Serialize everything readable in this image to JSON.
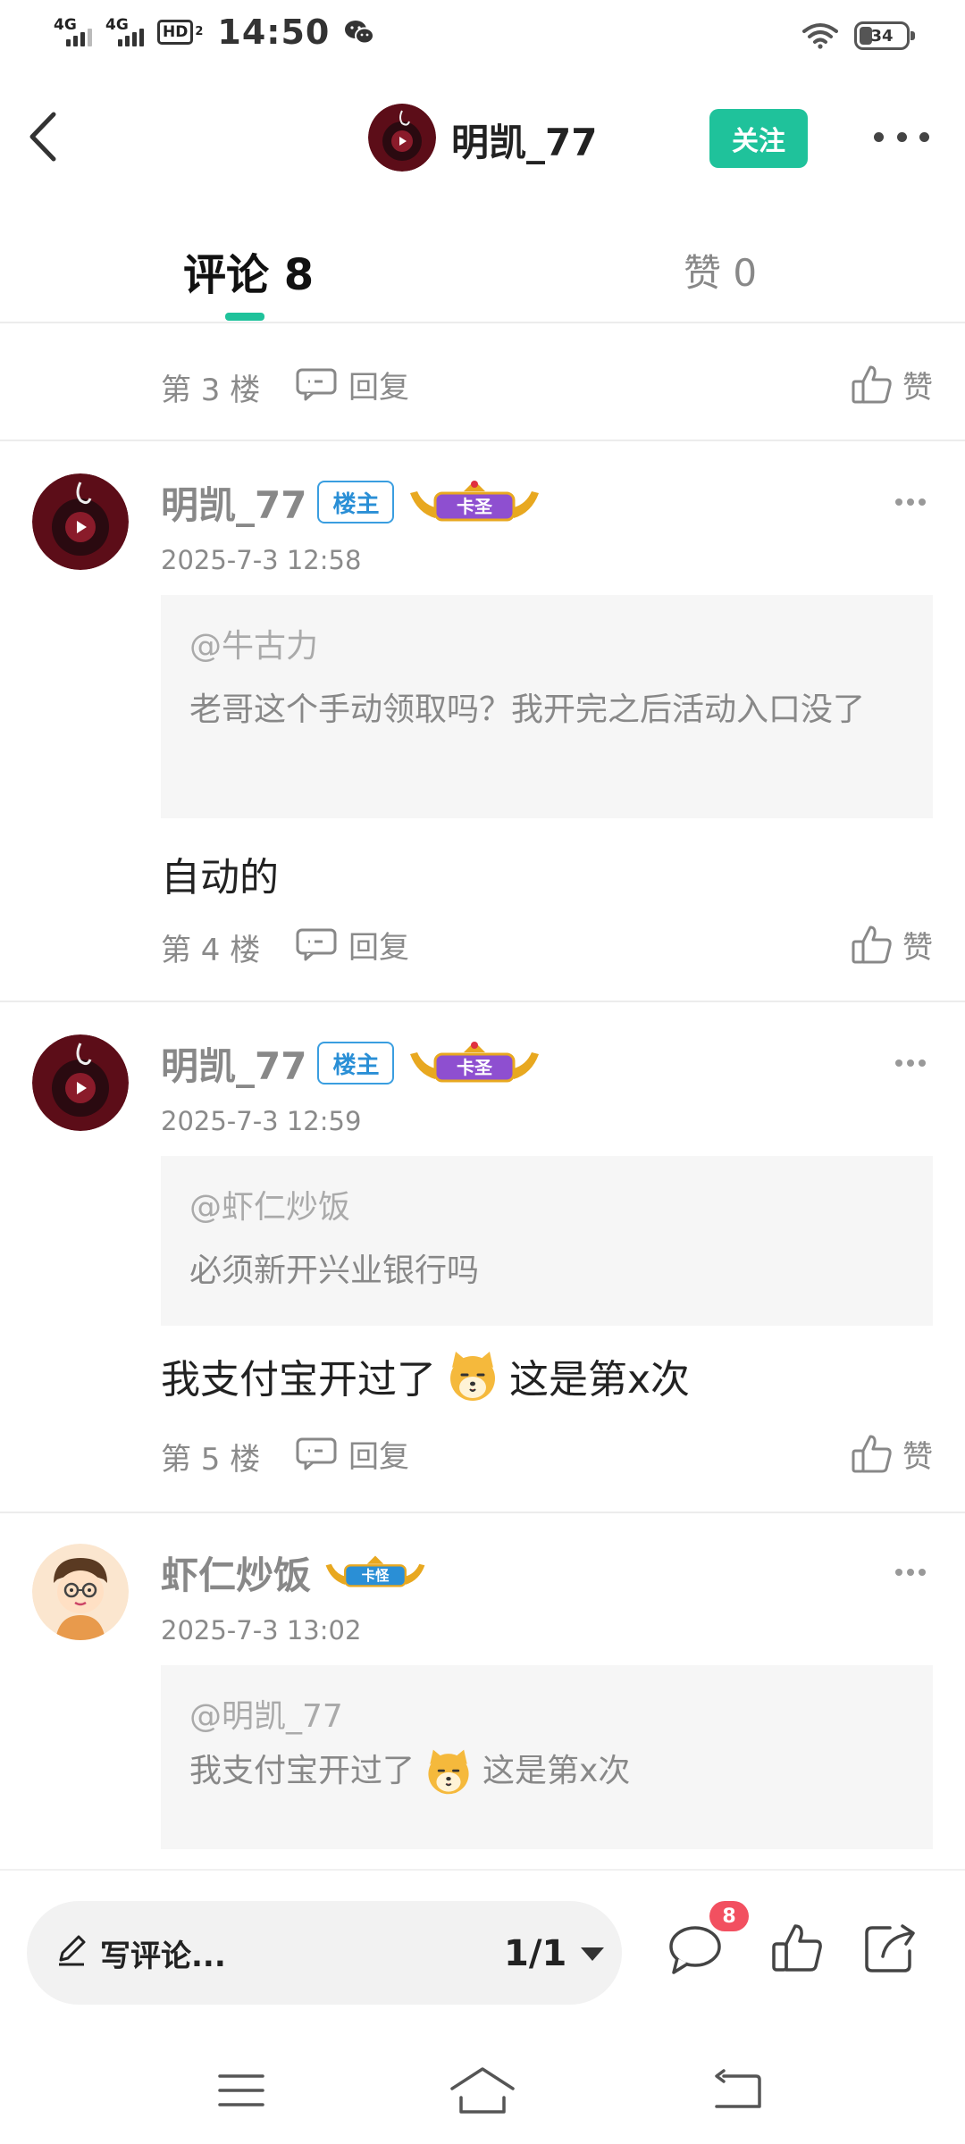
{
  "status_bar": {
    "net1": "4G",
    "net2": "4G",
    "hd": "HD",
    "hd_sub": "2",
    "time": "14:50",
    "battery": "34"
  },
  "header": {
    "username": "明凯_77",
    "follow_label": "关注"
  },
  "tabs": {
    "comments_label": "评论 8",
    "likes_label": "赞 0"
  },
  "feed": {
    "partial_floor": {
      "floor": "第 3 楼",
      "reply_label": "回复",
      "like_label": "赞"
    },
    "comments": [
      {
        "username": "明凯_77",
        "owner_badge": "楼主",
        "rank_badge": "卡圣",
        "time": "2025-7-3 12:58",
        "quote_at": "@牛古力",
        "quote_text": "老哥这个手动领取吗？我开完之后活动入口没了",
        "text": "自动的",
        "floor": "第 4 楼",
        "reply_label": "回复",
        "like_label": "赞"
      },
      {
        "username": "明凯_77",
        "owner_badge": "楼主",
        "rank_badge": "卡圣",
        "time": "2025-7-3 12:59",
        "quote_at": "@虾仁炒饭",
        "quote_text": "必须新开兴业银行吗",
        "text_before": "我支付宝开过了",
        "text_after": "这是第x次",
        "floor": "第 5 楼",
        "reply_label": "回复",
        "like_label": "赞"
      },
      {
        "username": "虾仁炒饭",
        "rank_badge": "卡怪",
        "time": "2025-7-3 13:02",
        "quote_at": "@明凯_77",
        "quote_before": "我支付宝开过了",
        "quote_after": "这是第x次"
      }
    ]
  },
  "bottom_bar": {
    "compose_placeholder": "写评论...",
    "page_indicator": "1/1",
    "comment_count": "8"
  },
  "icons": {
    "back": "chevron-left-icon",
    "more": "more-horizontal-icon",
    "reply": "reply-bubble-icon",
    "like": "thumbs-up-icon",
    "pencil": "pencil-icon",
    "comment": "comment-bubble-icon",
    "share": "share-icon",
    "emoji": "shiba-emoji-icon"
  },
  "colors": {
    "accent": "#1fc29b",
    "owner_badge": "#2a8fd6",
    "badge_red": "#f25060",
    "rank_purple": "#8e4fd0"
  }
}
